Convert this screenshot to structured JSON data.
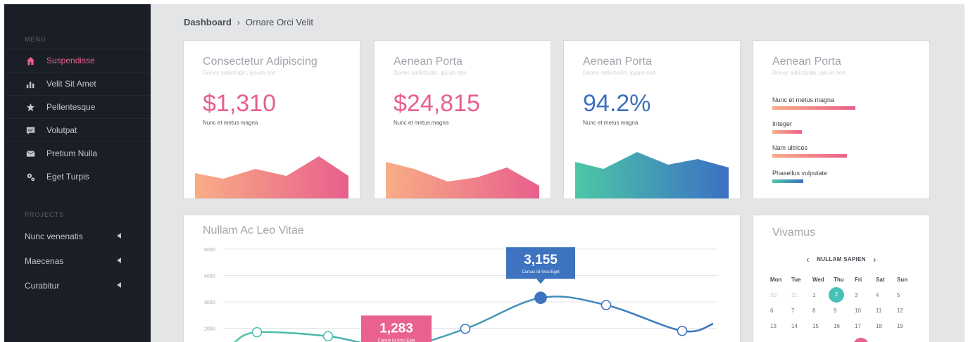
{
  "sidebar": {
    "menu_label": "MENU",
    "items": [
      {
        "label": "Suspendisse",
        "icon": "home-icon",
        "active": true
      },
      {
        "label": "Velit Sit Amet",
        "icon": "bar-chart-icon",
        "active": false
      },
      {
        "label": "Pellentesque",
        "icon": "star-icon",
        "active": false
      },
      {
        "label": "Volutpat",
        "icon": "message-icon",
        "active": false
      },
      {
        "label": "Pretium Nulla",
        "icon": "envelope-icon",
        "active": false
      },
      {
        "label": "Eget Turpis",
        "icon": "gears-icon",
        "active": false
      }
    ],
    "projects_label": "PROJECTS",
    "projects": [
      {
        "label": "Nunc venenatis",
        "icon": "caret-left-icon"
      },
      {
        "label": "Maecenas",
        "icon": "caret-left-icon"
      },
      {
        "label": "Curabitur",
        "icon": "caret-left-icon"
      }
    ]
  },
  "breadcrumb": {
    "root": "Dashboard",
    "current": "Ornare Orci Velit"
  },
  "cards": [
    {
      "title": "Consectetur Adipiscing",
      "subtitle": "Donec sollicitudin, ipsum non",
      "value": "$1,310",
      "caption": "Nunc et metus magna",
      "color_from": "#f8ad86",
      "color_to": "#e95f8c"
    },
    {
      "title": "Aenean Porta",
      "subtitle": "Donec sollicitudin, ipsum non",
      "value": "$24,815",
      "caption": "Nunc et metus magna",
      "color_from": "#f8ad86",
      "color_to": "#e95f8c"
    },
    {
      "title": "Aenean Porta",
      "subtitle": "Donec sollicitudin, ipsum non",
      "value": "94.2%",
      "caption": "Nunc et metus magna",
      "color_from": "#4dc7a6",
      "color_to": "#3b70c4"
    }
  ],
  "bars_card": {
    "title": "Aenean Porta",
    "subtitle": "Donec sollicitudin, ipsum non",
    "bars": [
      {
        "label": "Nunc et metus magna",
        "fraction": 1.0,
        "color_from": "#f8ad86",
        "color_to": "#e95f8c"
      },
      {
        "label": "Integer",
        "fraction": 0.36,
        "color_from": "#f8ad86",
        "color_to": "#e95f8c"
      },
      {
        "label": "Nam ultrices",
        "fraction": 0.9,
        "color_from": "#f8ad86",
        "color_to": "#e95f8c"
      },
      {
        "label": "Phasellus vulputate",
        "fraction": 0.37,
        "color_from": "#4dc7a6",
        "color_to": "#3b70c4"
      }
    ]
  },
  "line_chart": {
    "title": "Nullam Ac Leo Vitae",
    "chart_data": {
      "type": "line",
      "ylim": [
        1500,
        5000
      ],
      "yticks": [
        "5000",
        "4000",
        "3000",
        "2000"
      ],
      "points": [
        {
          "x": 0,
          "y": 1850
        },
        {
          "x": 1,
          "y": 1700
        },
        {
          "x": 2,
          "y": 1283
        },
        {
          "x": 3,
          "y": 1980
        },
        {
          "x": 4,
          "y": 3155
        },
        {
          "x": 5,
          "y": 2880
        },
        {
          "x": 6,
          "y": 1900
        }
      ],
      "callouts": [
        {
          "value": "3,155",
          "label": "Cursus Id Arcu Eget",
          "color": "#3d73bf"
        },
        {
          "value": "1,283",
          "label": "Cursus Id Arcu Eget",
          "color": "#e9628e"
        }
      ],
      "color_from": "#4dc7a6",
      "color_to": "#3b70c4"
    }
  },
  "calendar": {
    "title": "Vivamus",
    "month": "NULLAM SAPIEN",
    "weekdays": [
      "Mon",
      "Tue",
      "Wed",
      "Thu",
      "Fri",
      "Sat",
      "Sun"
    ],
    "weeks": [
      [
        "30",
        "31",
        "1",
        "2",
        "3",
        "4",
        "5"
      ],
      [
        "6",
        "7",
        "8",
        "9",
        "10",
        "11",
        "12"
      ],
      [
        "13",
        "14",
        "15",
        "16",
        "17",
        "18",
        "19"
      ]
    ],
    "selected": "2"
  }
}
